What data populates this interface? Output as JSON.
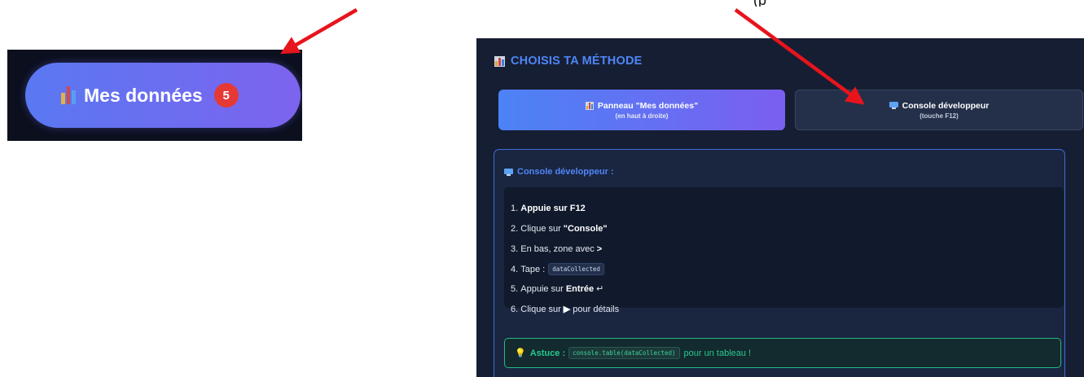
{
  "top_clipped_text": "(p",
  "zoom_badge": {
    "label": "Mes données",
    "count": "5"
  },
  "panel": {
    "title": "CHOISIS TA MÉTHODE",
    "methods": [
      {
        "label": "Panneau \"Mes données\"",
        "sub": "(en haut à droite)",
        "selected": true
      },
      {
        "label": "Console développeur",
        "sub": "(touche F12)",
        "selected": false
      }
    ],
    "console": {
      "heading": "Console développeur :",
      "steps": [
        {
          "num": "1.",
          "pre": "",
          "bold": "Appuie sur F12",
          "post": ""
        },
        {
          "num": "2.",
          "pre": "Clique sur",
          "bold": "\"Console\"",
          "post": ""
        },
        {
          "num": "3.",
          "pre": "En bas, zone avec",
          "bold": ">",
          "post": ""
        },
        {
          "num": "4.",
          "pre": "Tape :",
          "code": "dataCollected"
        },
        {
          "num": "5.",
          "pre": "Appuie sur",
          "bold": "Entrée",
          "post": "↵"
        },
        {
          "num": "6.",
          "pre": "Clique sur",
          "bold": "▶",
          "post": "pour détails"
        }
      ]
    },
    "tip": {
      "label": "Astuce :",
      "code": "console.table(dataCollected)",
      "text": "pour un tableau !"
    }
  },
  "colors": {
    "accent_blue": "#4f86f7",
    "badge_red": "#e53935",
    "tip_green": "#27c98f",
    "arrow_red": "#e8141c"
  }
}
